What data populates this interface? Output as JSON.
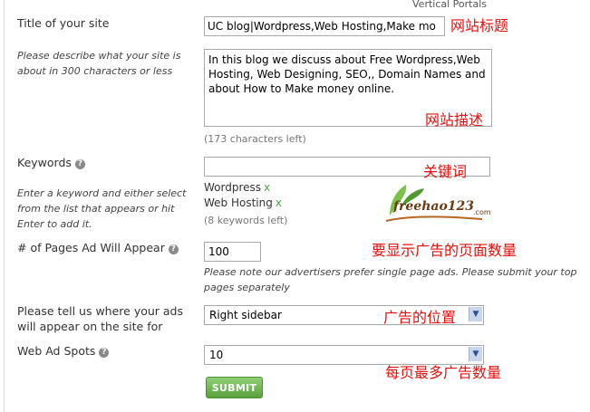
{
  "form": {
    "title": {
      "label": "Title of your site",
      "value": "UC blog|Wordpress,Web Hosting,Make mo",
      "annotation": "网站标题"
    },
    "description": {
      "help": "Please describe what your site is about in 300 characters or less",
      "value": "In this blog we discuss about Free Wordpress,Web Hosting, Web Designing, SEO,, Domain Names and about How to Make money online.",
      "chars_left": "(173 characters left)",
      "annotation": "网站描述",
      "behind_text": "Vertical Portals"
    },
    "keywords": {
      "label": "Keywords",
      "help": "Enter a keyword and either select from the list that appears or hit Enter to add it.",
      "value": "",
      "items": [
        {
          "text": "Wordpress",
          "remove": "x"
        },
        {
          "text": "Web Hosting",
          "remove": "x"
        }
      ],
      "count": "(8 keywords left)",
      "annotation": "关键词"
    },
    "pages": {
      "label": "# of Pages Ad Will Appear",
      "value": "100",
      "note": "Please note our advertisers prefer single page ads. Please submit your top pages separately",
      "annotation": "要显示广告的页面数量"
    },
    "position": {
      "label": "Please tell us where your ads will appear on the site for",
      "selected": "Right sidebar",
      "annotation": "广告的位置"
    },
    "spots": {
      "label": "Web Ad Spots",
      "selected": "10",
      "annotation": "每页最多广告数量"
    },
    "submit_label": "SUBMIT"
  },
  "watermark": {
    "text": "freehao123",
    "suffix": ".com"
  },
  "colors": {
    "annotation_red": "#e3110e",
    "remove_x_green": "#4da640",
    "submit_green": "#6ab44b"
  },
  "icons": {
    "help": "question-circle-icon",
    "dropdown": "chevron-down-icon"
  }
}
